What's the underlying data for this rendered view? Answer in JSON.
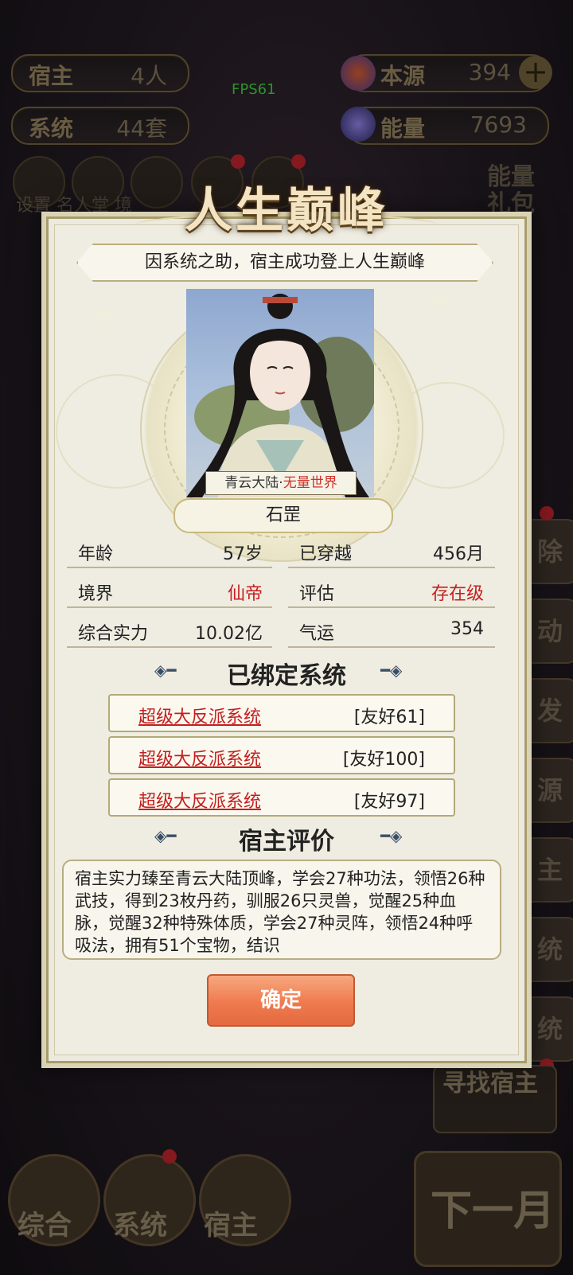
{
  "top": {
    "host_label": "宿主",
    "host_value": "4人",
    "system_label": "系统",
    "system_value": "44套",
    "source_label": "本源",
    "source_value": "394",
    "energy_label": "能量",
    "energy_value": "7693",
    "fps": "FPS61"
  },
  "bg": {
    "row_labels": "设置 名人堂 境",
    "energy_gift": "能量礼包",
    "side_buttons": [
      "除",
      "动",
      "发",
      "源",
      "主",
      "统",
      "统"
    ],
    "search_host": "寻找宿主",
    "bottom_tabs": [
      "综合",
      "系统",
      "宿主"
    ],
    "next_month": "下一月"
  },
  "modal": {
    "title": "人生巅峰",
    "banner": "因系统之助，宿主成功登上人生巅峰",
    "world_prefix": "青云大陆·",
    "world_suffix": "无量世界",
    "name": "石罡",
    "stats": {
      "age_label": "年龄",
      "age_value": "57岁",
      "traveled_label": "已穿越",
      "traveled_value": "456月",
      "realm_label": "境界",
      "realm_value": "仙帝",
      "assess_label": "评估",
      "assess_value": "存在级",
      "power_label": "综合实力",
      "power_value": "10.02亿",
      "luck_label": "气运",
      "luck_value": "354"
    },
    "bound_title": "已绑定系统",
    "systems": [
      {
        "name": "超级大反派系统",
        "friend": "[友好61]"
      },
      {
        "name": "超级大反派系统",
        "friend": "[友好100]"
      },
      {
        "name": "超级大反派系统",
        "friend": "[友好97]"
      }
    ],
    "eval_title": "宿主评价",
    "eval_text": "宿主实力臻至青云大陆顶峰，学会27种功法，领悟26种武技，得到23枚丹药，驯服26只灵兽，觉醒25种血脉，觉醒32种特殊体质，学会27种灵阵，领悟24种呼吸法，拥有51个宝物，结识",
    "confirm": "确定"
  },
  "colors": {
    "accent_red": "#c41e1e",
    "confirm": "#ef7a4e",
    "fps_green": "#39c53a"
  }
}
